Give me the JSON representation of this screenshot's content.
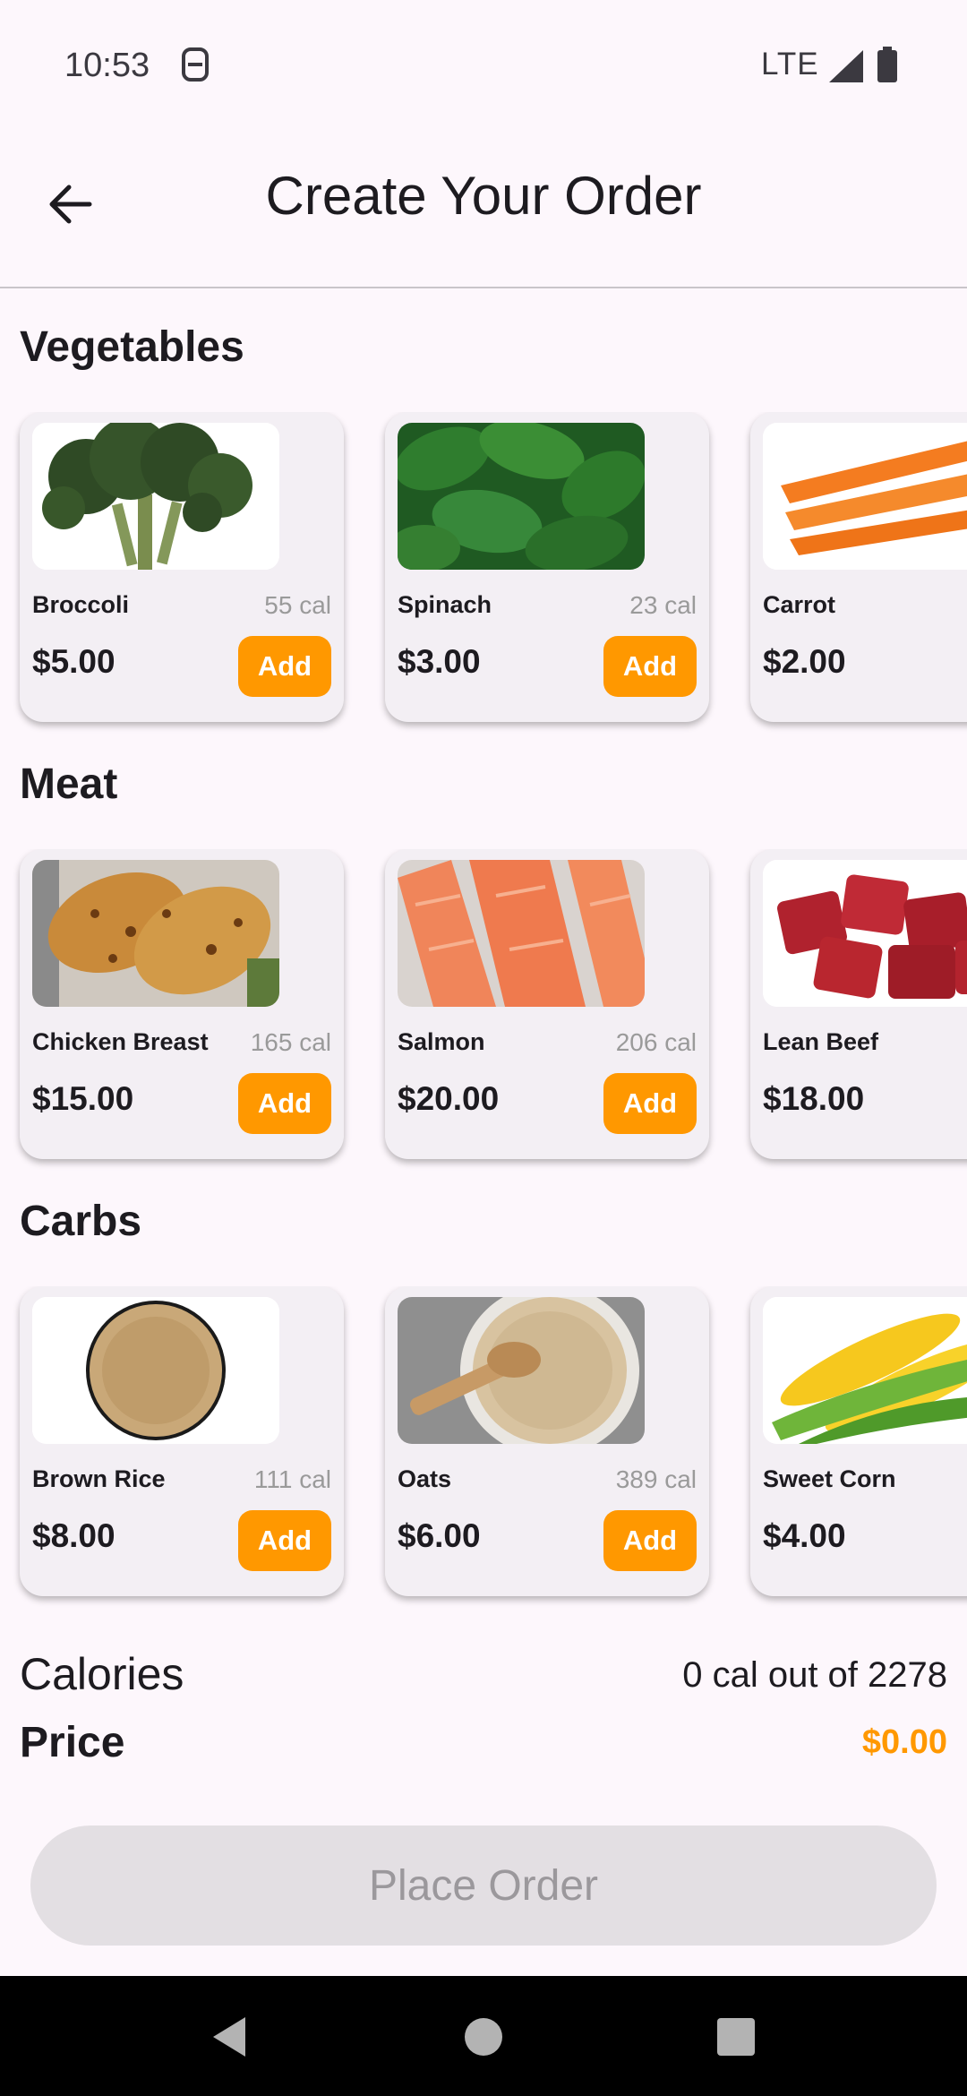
{
  "status_bar": {
    "time": "10:53",
    "network": "LTE"
  },
  "header": {
    "title": "Create Your Order",
    "back_icon": "arrow-left-icon"
  },
  "sections": [
    {
      "title": "Vegetables",
      "items": [
        {
          "name": "Broccoli",
          "cal": "55 cal",
          "price": "$5.00",
          "add": "Add"
        },
        {
          "name": "Spinach",
          "cal": "23 cal",
          "price": "$3.00",
          "add": "Add"
        },
        {
          "name": "Carrot",
          "price": "$2.00"
        }
      ]
    },
    {
      "title": "Meat",
      "items": [
        {
          "name": "Chicken Breast",
          "cal": "165 cal",
          "price": "$15.00",
          "add": "Add"
        },
        {
          "name": "Salmon",
          "cal": "206 cal",
          "price": "$20.00",
          "add": "Add"
        },
        {
          "name": "Lean Beef",
          "price": "$18.00"
        }
      ]
    },
    {
      "title": "Carbs",
      "items": [
        {
          "name": "Brown Rice",
          "cal": "111 cal",
          "price": "$8.00",
          "add": "Add"
        },
        {
          "name": "Oats",
          "cal": "389 cal",
          "price": "$6.00",
          "add": "Add"
        },
        {
          "name": "Sweet Corn",
          "price": "$4.00"
        }
      ]
    }
  ],
  "summary": {
    "calories_label": "Calories",
    "calories_value": "0 cal out of 2278",
    "price_label": "Price",
    "price_value": "$0.00"
  },
  "place_order": {
    "label": "Place Order"
  },
  "colors": {
    "accent": "#ff9800",
    "background": "#fdf7fc",
    "card": "#f3eff4",
    "disabled_button": "#e3dfe3"
  }
}
